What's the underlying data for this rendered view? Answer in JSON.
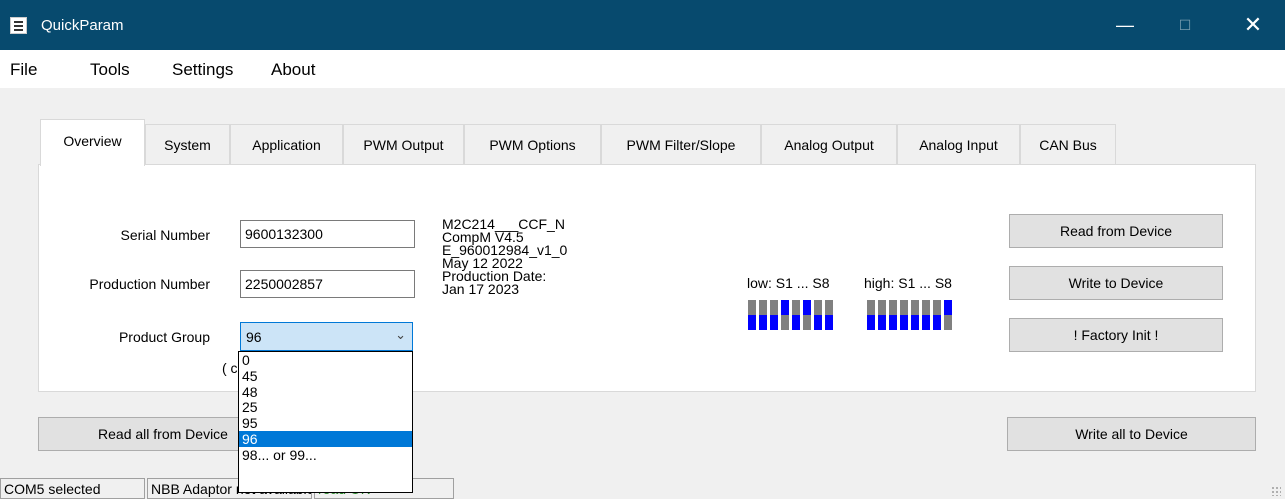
{
  "window": {
    "title": "QuickParam",
    "minimize": "—",
    "maximize": "☐",
    "close": "✕"
  },
  "menu": [
    "File",
    "Tools",
    "Settings",
    "About"
  ],
  "tabs": [
    "Overview",
    "System",
    "Application",
    "PWM Output",
    "PWM Options",
    "PWM Filter/Slope",
    "Analog Output",
    "Analog Input",
    "CAN Bus"
  ],
  "overview": {
    "serial_label": "Serial Number",
    "serial_value": "9600132300",
    "production_label": "Production Number",
    "production_value": "2250002857",
    "group_label": "Product Group",
    "group_value": "96",
    "group_note": "( c",
    "info_lines": [
      "M2C214___CCF_N",
      "CompM V4.5",
      "E_960012984_v1_0",
      "May 12 2022",
      "Production Date:",
      "Jan 17 2023"
    ],
    "dip_low_label": "low: S1 ... S8",
    "dip_high_label": "high: S1 ... S8",
    "dip_low": [
      1,
      1,
      1,
      0,
      1,
      0,
      1,
      1
    ],
    "dip_high": [
      1,
      1,
      1,
      1,
      1,
      1,
      1,
      0
    ],
    "btn_read": "Read from Device",
    "btn_write": "Write to Device",
    "btn_factory": "! Factory Init !"
  },
  "dropdown": {
    "options": [
      "0",
      "45",
      "48",
      "25",
      "95",
      "96",
      "98... or 99..."
    ],
    "selected": "96"
  },
  "bottom": {
    "read_all": "Read all from Device",
    "write_all": "Write all to Device"
  },
  "status": {
    "port": "COM5 selected",
    "adaptor": "NBB Adaptor not available",
    "state": "read OK"
  },
  "colors": {
    "title_bg": "#074a6e",
    "dip_on": "#0000ff",
    "dip_off": "#808080",
    "select": "#0078d7"
  }
}
